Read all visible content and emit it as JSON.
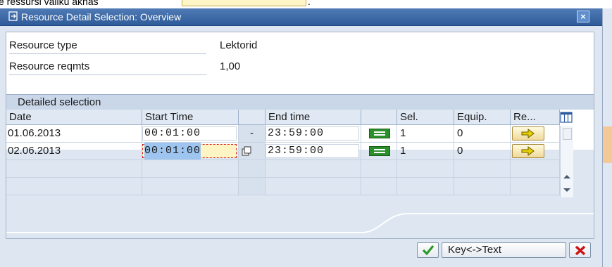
{
  "caption": {
    "prefix": "e ressursi valiku aknas",
    "suffix": "."
  },
  "window": {
    "title": "Resource Detail Selection: Overview",
    "close_symbol": "×"
  },
  "fields": [
    {
      "label": "Resource type",
      "value": "Lektorid"
    },
    {
      "label": "Resource reqmts",
      "value": "1,00"
    }
  ],
  "group_title": "Detailed selection",
  "table": {
    "columns": {
      "date": "Date",
      "start": "Start Time",
      "end": "End time",
      "sel": "Sel.",
      "equip": "Equip.",
      "re": "Re..."
    },
    "rows": [
      {
        "date": "01.06.2013",
        "start": "00:01:00",
        "sep": "-",
        "end": "23:59:00",
        "sel": "1",
        "equip": "0"
      },
      {
        "date": "02.06.2013",
        "start": "00:01:00",
        "sep": "",
        "end": "23:59:00",
        "sel": "1",
        "equip": "0"
      }
    ]
  },
  "footer": {
    "key_text_label": "Key<->Text"
  },
  "icons": [
    "edit-document-icon",
    "close-icon",
    "green-equal-icon",
    "yellow-arrow-icon",
    "copy-icon",
    "table-config-icon",
    "scroll-up-icon",
    "scroll-down-icon",
    "confirm-check-icon",
    "cancel-x-icon"
  ],
  "colors": {
    "title_bar": "#2f5c9a",
    "panel": "#dde6f1",
    "green_button": "#2b8f2b",
    "arrow": "#d8c400",
    "cancel": "#cc1111",
    "check": "#2a9a2a"
  }
}
